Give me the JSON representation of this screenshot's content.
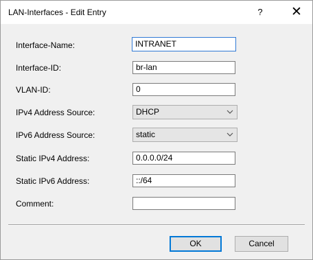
{
  "window": {
    "title": "LAN-Interfaces - Edit Entry",
    "help_glyph": "?",
    "close_glyph": "✕"
  },
  "form": {
    "interface_name": {
      "label": "Interface-Name:",
      "value": "INTRANET"
    },
    "interface_id": {
      "label": "Interface-ID:",
      "value": "br-lan"
    },
    "vlan_id": {
      "label": "VLAN-ID:",
      "value": "0"
    },
    "ipv4_source": {
      "label": "IPv4 Address Source:",
      "value": "DHCP"
    },
    "ipv6_source": {
      "label": "IPv6 Address Source:",
      "value": "static"
    },
    "static_ipv4": {
      "label": "Static IPv4 Address:",
      "value": "0.0.0.0/24"
    },
    "static_ipv6": {
      "label": "Static IPv6 Address:",
      "value": "::/64"
    },
    "comment": {
      "label": "Comment:",
      "value": ""
    }
  },
  "buttons": {
    "ok_label": "OK",
    "cancel_label": "Cancel"
  },
  "icons": {
    "dropdown": "chevron-down-icon"
  },
  "colors": {
    "focus_border": "#2f79d5",
    "default_button_border": "#0078d7",
    "dialog_background": "#f0f0f0"
  }
}
